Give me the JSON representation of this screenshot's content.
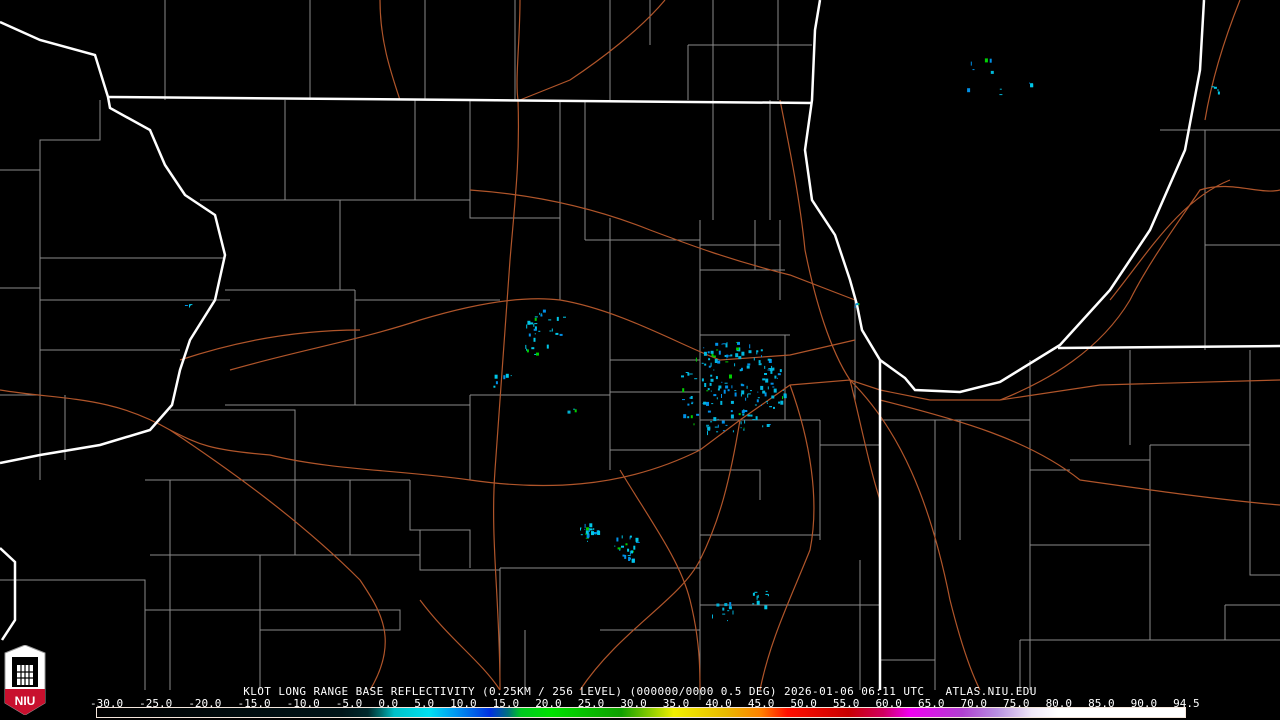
{
  "title": "KLOT LONG RANGE BASE REFLECTIVITY (0.25KM / 256 LEVEL) (000000/0000 0.5 DEG) 2026-01-06 06:11 UTC   ATLAS.NIU.EDU",
  "logo_text": "NIU",
  "colorbar": {
    "labels": [
      "-30.0",
      "-25.0",
      "-20.0",
      "-15.0",
      "-10.0",
      "-5.0",
      "0.0",
      "5.0",
      "10.0",
      "15.0",
      "20.0",
      "25.0",
      "30.0",
      "35.0",
      "40.0",
      "45.0",
      "50.0",
      "55.0",
      "60.0",
      "65.0",
      "70.0",
      "75.0",
      "80.0",
      "85.0",
      "90.0",
      "94.5"
    ],
    "min": -30,
    "max": 94.5,
    "stops": [
      {
        "dbz": -30,
        "color": "#000000"
      },
      {
        "dbz": -2,
        "color": "#001418"
      },
      {
        "dbz": 1,
        "color": "#00282c"
      },
      {
        "dbz": 2.5,
        "color": "#007070"
      },
      {
        "dbz": 4,
        "color": "#00c0c8"
      },
      {
        "dbz": 8,
        "color": "#00e0f0"
      },
      {
        "dbz": 11,
        "color": "#0098f0"
      },
      {
        "dbz": 15,
        "color": "#0030e0"
      },
      {
        "dbz": 17,
        "color": "#007080"
      },
      {
        "dbz": 18.5,
        "color": "#00c820"
      },
      {
        "dbz": 22,
        "color": "#00e000"
      },
      {
        "dbz": 30,
        "color": "#10a000"
      },
      {
        "dbz": 33,
        "color": "#80c800"
      },
      {
        "dbz": 36,
        "color": "#f0f000"
      },
      {
        "dbz": 42,
        "color": "#e8b800"
      },
      {
        "dbz": 46,
        "color": "#ff8000"
      },
      {
        "dbz": 49,
        "color": "#ff1000"
      },
      {
        "dbz": 56,
        "color": "#c80000"
      },
      {
        "dbz": 60,
        "color": "#d00060"
      },
      {
        "dbz": 63,
        "color": "#f000f0"
      },
      {
        "dbz": 69,
        "color": "#b040d0"
      },
      {
        "dbz": 73,
        "color": "#b890e0"
      },
      {
        "dbz": 77,
        "color": "#f0e8f8"
      },
      {
        "dbz": 80,
        "color": "#ffffff"
      },
      {
        "dbz": 94.5,
        "color": "#ffffff"
      }
    ]
  }
}
